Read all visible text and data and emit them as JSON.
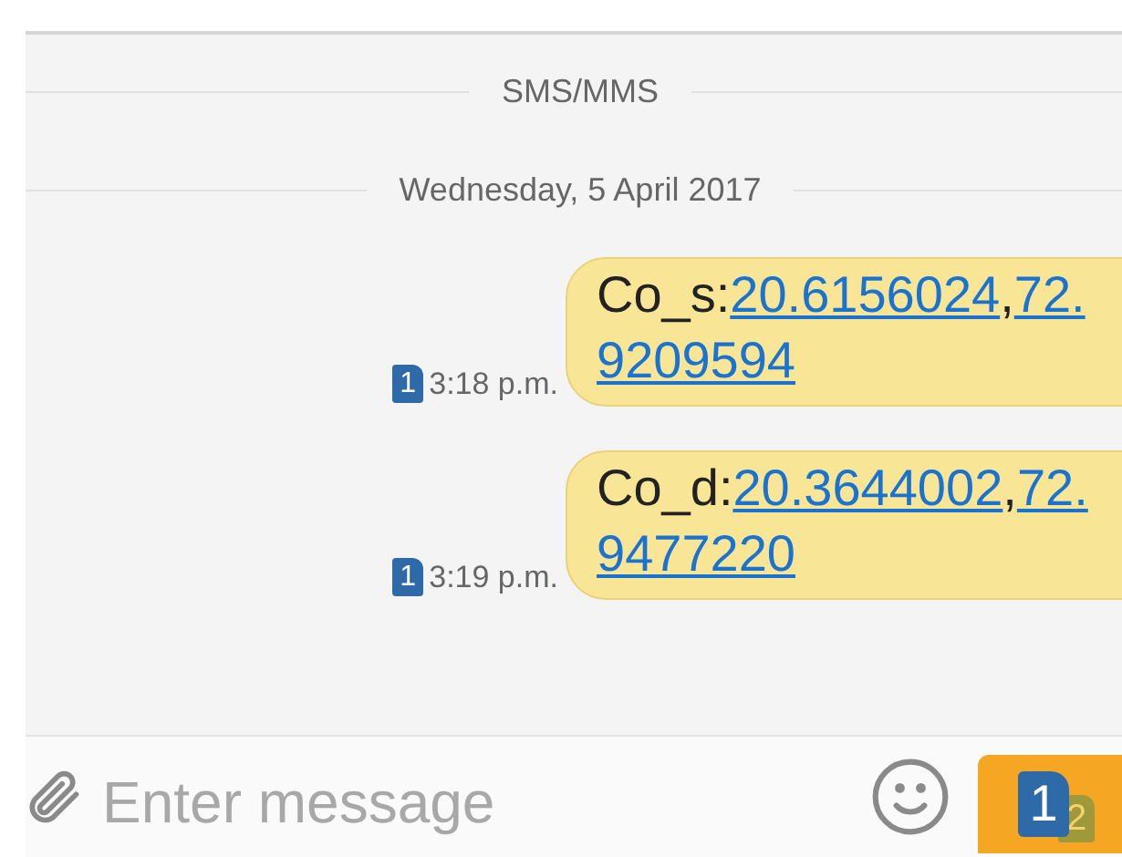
{
  "channel_divider": "SMS/MMS",
  "date_divider": "Wednesday, 5 April 2017",
  "messages": [
    {
      "sim": "1",
      "time": "3:18 p.m.",
      "segments": [
        {
          "kind": "plain",
          "text": "Co_s:"
        },
        {
          "kind": "link",
          "text": "20.6156024"
        },
        {
          "kind": "plain",
          "text": ","
        },
        {
          "kind": "link",
          "text": "72.9209594"
        }
      ]
    },
    {
      "sim": "1",
      "time": "3:19 p.m.",
      "segments": [
        {
          "kind": "plain",
          "text": "Co_d:"
        },
        {
          "kind": "link",
          "text": "20.3644002"
        },
        {
          "kind": "plain",
          "text": ","
        },
        {
          "kind": "link",
          "text": "72.9477220"
        }
      ]
    }
  ],
  "composer": {
    "placeholder": "Enter message",
    "send_sims": [
      "1",
      "2"
    ]
  }
}
